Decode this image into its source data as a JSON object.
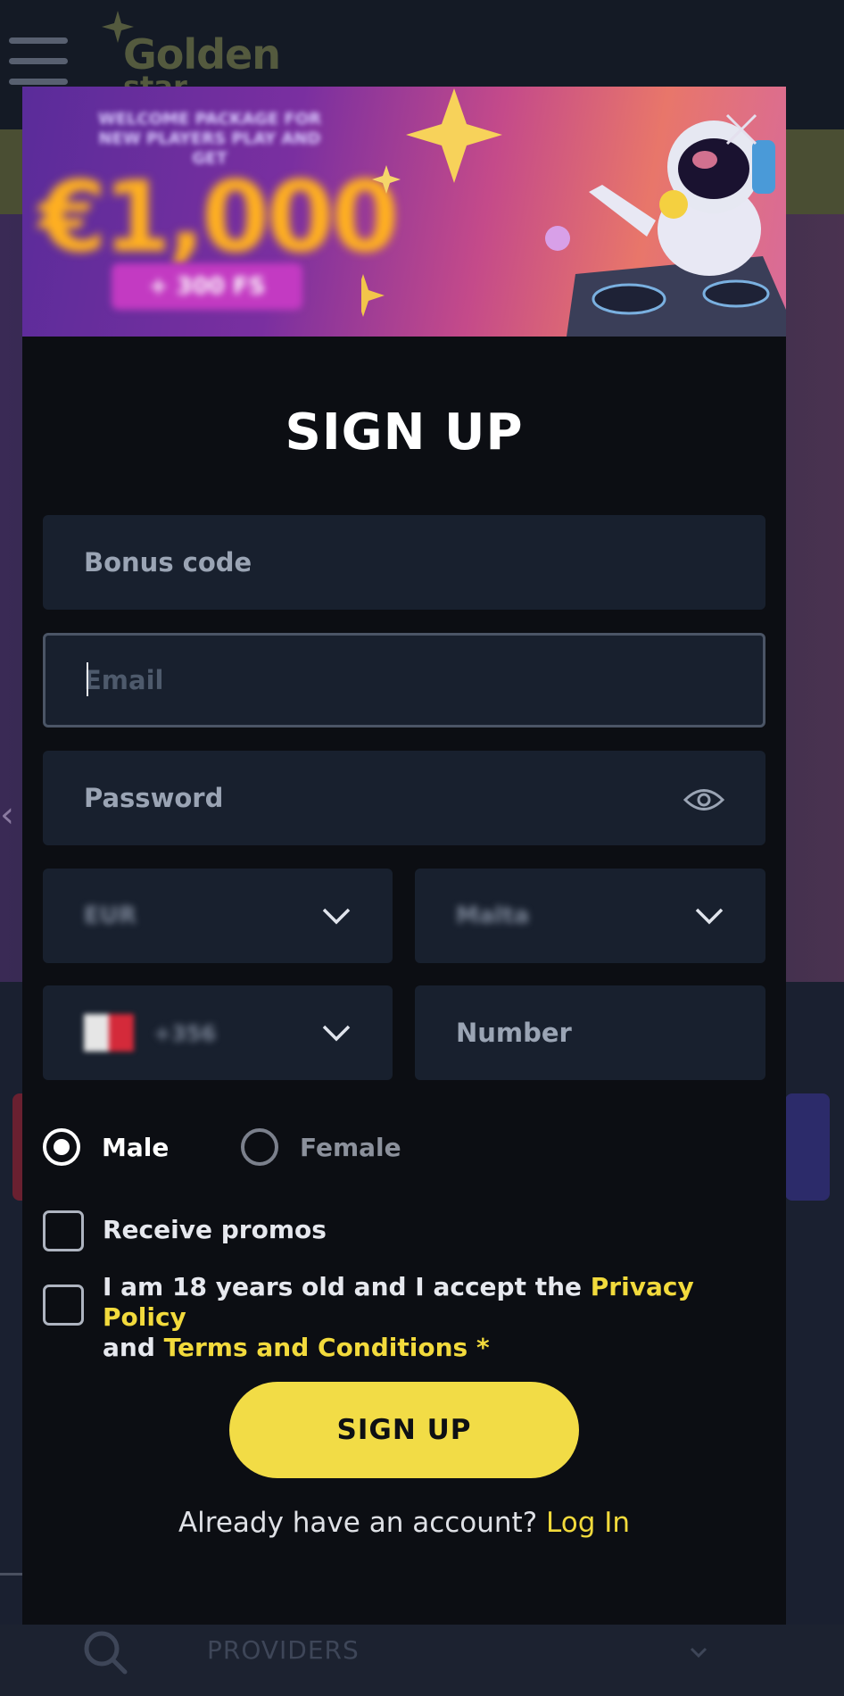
{
  "site": {
    "logo_text": "Golden",
    "logo_sub": "star",
    "bottom_nav_label": "PROVIDERS"
  },
  "banner": {
    "tagline": "WELCOME PACKAGE FOR NEW PLAYERS PLAY AND GET",
    "amount": "€1,000",
    "extra": "+ 300 FS"
  },
  "form": {
    "title": "SIGN UP",
    "bonus_placeholder": "Bonus code",
    "email_placeholder": "Email",
    "password_placeholder": "Password",
    "currency_value": "EUR",
    "country_value": "Malta",
    "dial_code": "+356",
    "number_placeholder": "Number",
    "gender": {
      "options": [
        "Male",
        "Female"
      ],
      "selected": "Male"
    },
    "promos_label": "Receive promos",
    "terms": {
      "prefix": "I am 18 years old and I accept the",
      "privacy_link": "Privacy Policy",
      "middle": "and",
      "terms_link": "Terms and Conditions",
      "required_mark": "*"
    },
    "submit_label": "SIGN UP",
    "login_prompt": "Already have an account?",
    "login_link": "Log In"
  },
  "colors": {
    "accent_yellow": "#f2dc46",
    "modal_bg": "#0c0e13",
    "field_bg": "#18202e"
  },
  "icons": [
    "menu-icon",
    "close-icon",
    "eye-icon",
    "chevron-down-icon",
    "search-icon"
  ]
}
